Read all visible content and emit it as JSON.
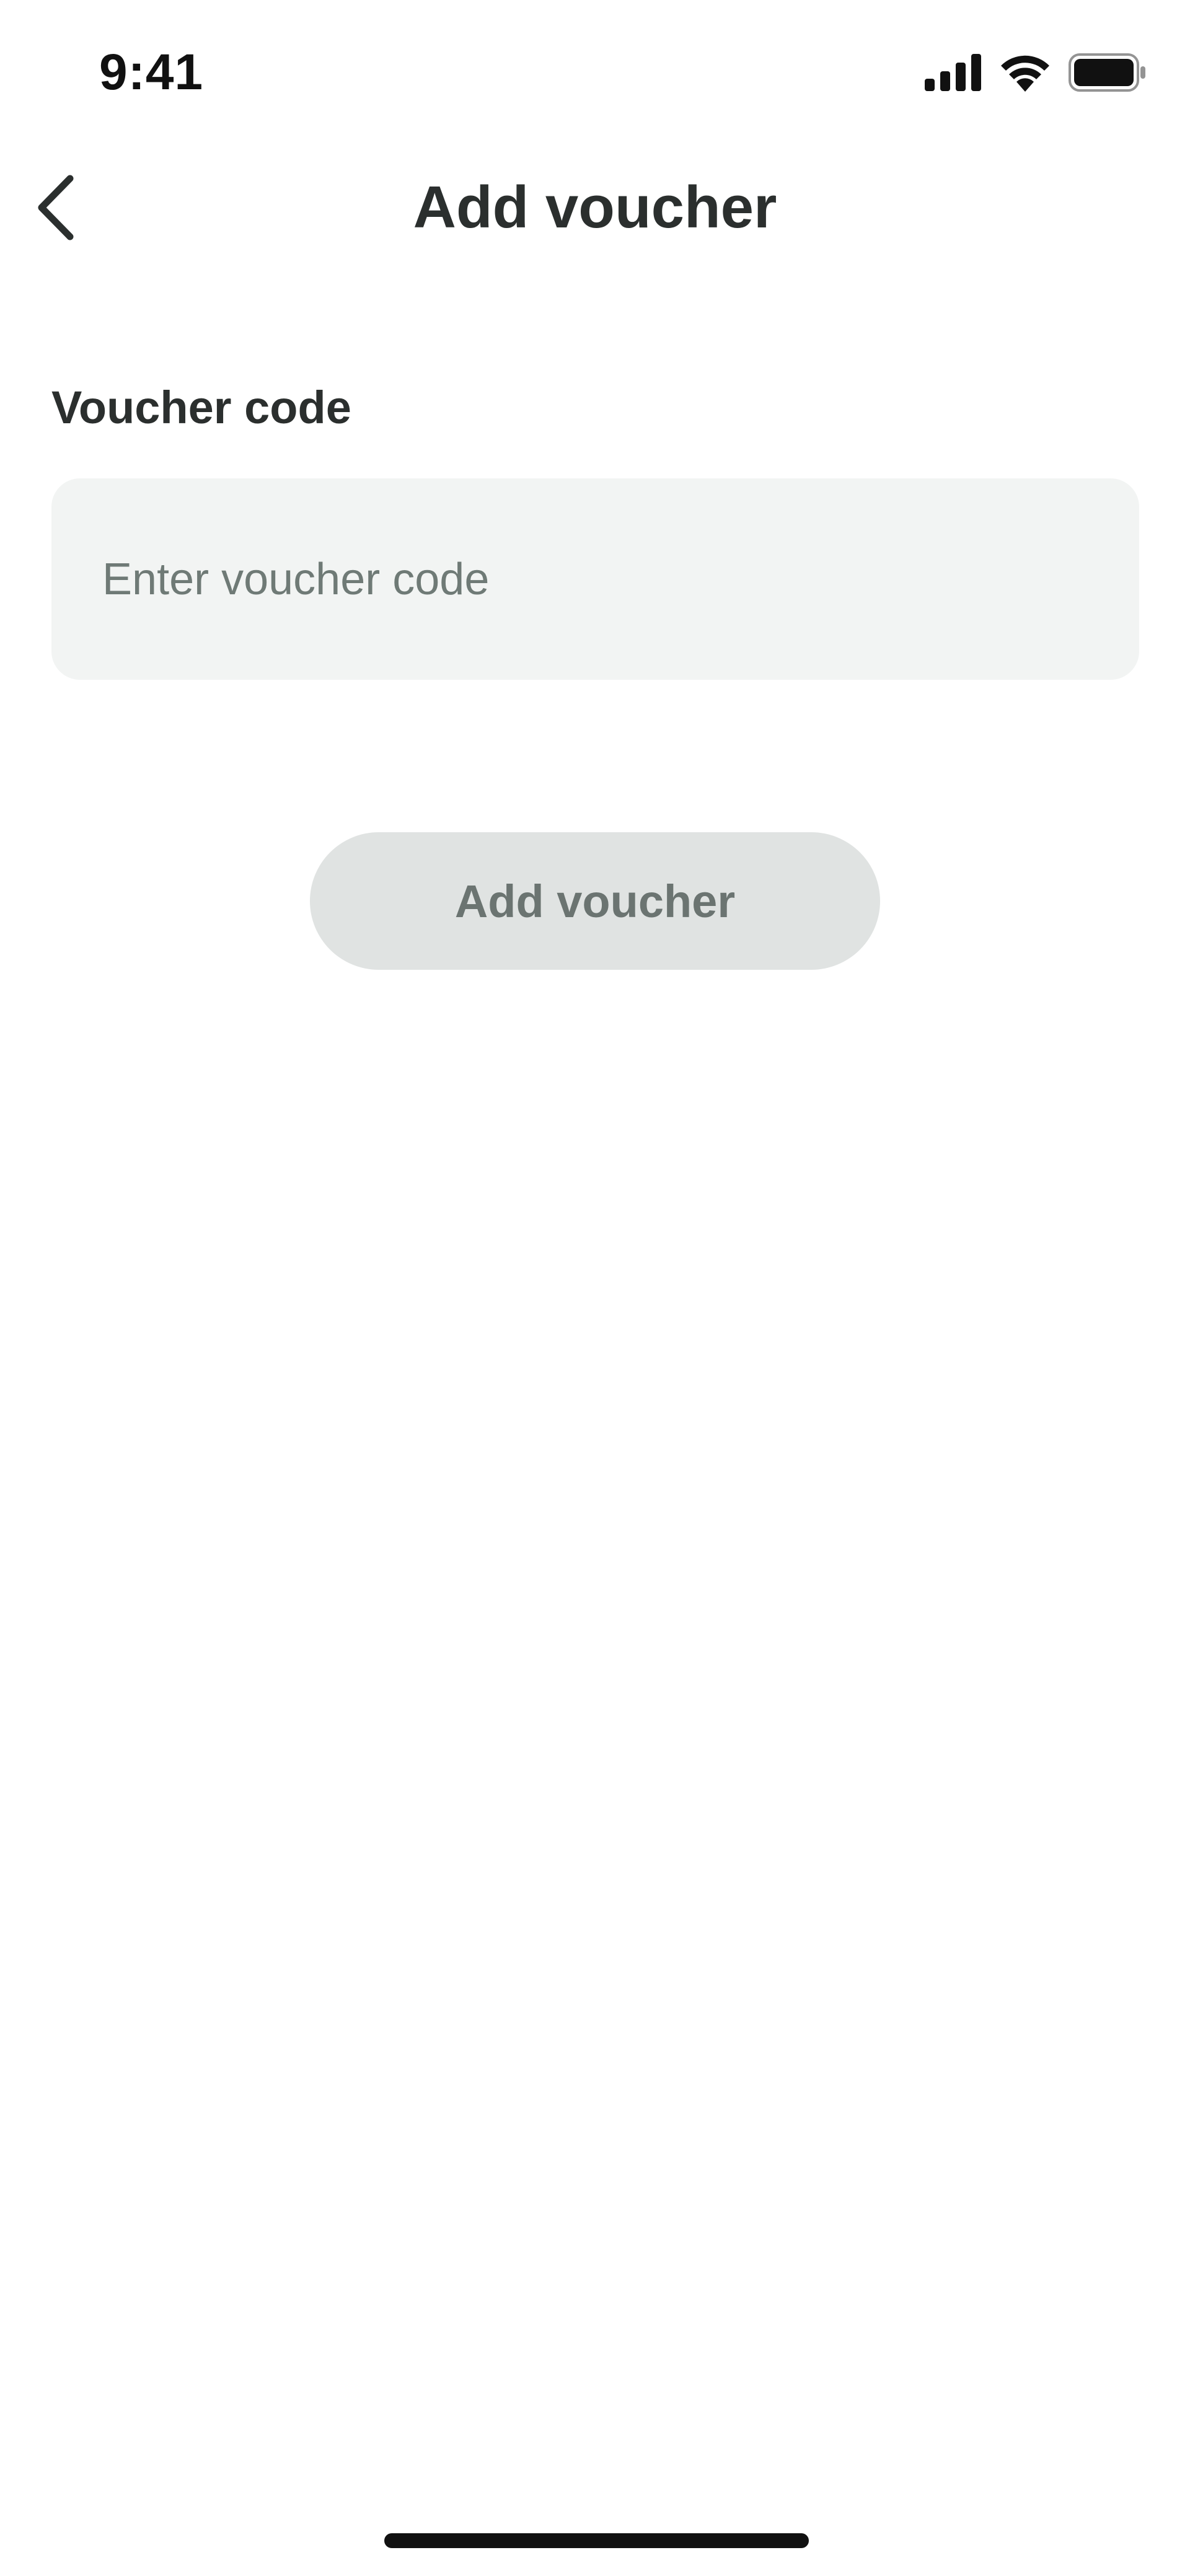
{
  "status_bar": {
    "time": "9:41",
    "icons": [
      "signal-icon",
      "wifi-icon",
      "battery-icon"
    ]
  },
  "header": {
    "back_icon": "chevron-left-icon",
    "title": "Add voucher"
  },
  "form": {
    "label": "Voucher code",
    "input_value": "",
    "input_placeholder": "Enter voucher code",
    "submit_label": "Add voucher",
    "submit_disabled": true
  },
  "colors": {
    "text_primary": "#2b2f2e",
    "input_background": "#f2f4f3",
    "placeholder": "#6f7a76",
    "button_disabled_bg": "#e0e3e2",
    "button_disabled_text": "#6b7471"
  }
}
